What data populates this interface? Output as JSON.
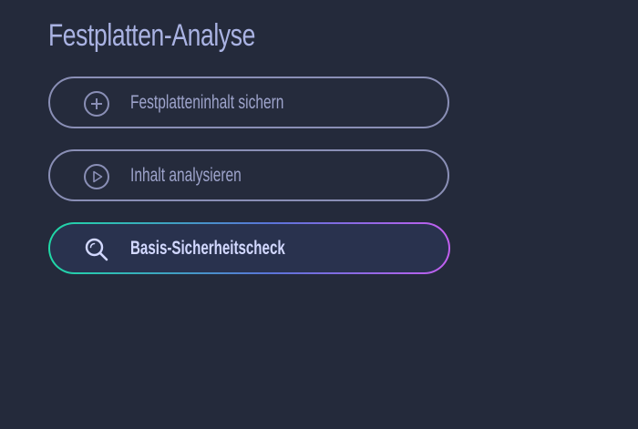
{
  "page": {
    "title": "Festplatten-Analyse"
  },
  "actions": [
    {
      "label": "Festplatteninhalt sichern",
      "icon": "plus-circle-icon",
      "state": "default"
    },
    {
      "label": "Inhalt analysieren",
      "icon": "play-circle-icon",
      "state": "default"
    },
    {
      "label": "Basis-Sicherheitscheck",
      "icon": "search-icon",
      "state": "active"
    }
  ],
  "colors": {
    "background": "#242a3b",
    "title": "#aab3e3",
    "button_border": "#8a8fb6",
    "button_text": "#9ea4cc",
    "active_text": "#d2d8ff",
    "active_gradient_start": "#1fd9a6",
    "active_gradient_end": "#c25ff0"
  }
}
